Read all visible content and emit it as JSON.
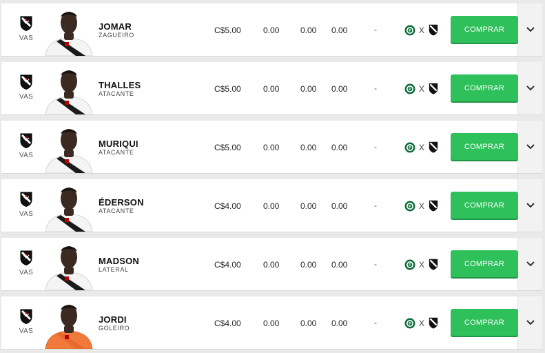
{
  "ui": {
    "buy_label": "COMPRAR",
    "match_separator": "X",
    "accent_color": "#2ec05b"
  },
  "players": [
    {
      "club": "VAS",
      "name": "JOMAR",
      "position": "ZAGUEIRO",
      "price": "C$5.00",
      "stat1": "0.00",
      "stat2": "0.00",
      "stat3": "0.00",
      "status": "-",
      "home_icon": "palmeiras-crest-icon",
      "away_icon": "vasco-crest-icon",
      "kit": "white"
    },
    {
      "club": "VAS",
      "name": "THALLES",
      "position": "ATACANTE",
      "price": "C$5.00",
      "stat1": "0.00",
      "stat2": "0.00",
      "stat3": "0.00",
      "status": "-",
      "home_icon": "palmeiras-crest-icon",
      "away_icon": "vasco-crest-icon",
      "kit": "white"
    },
    {
      "club": "VAS",
      "name": "MURIQUI",
      "position": "ATACANTE",
      "price": "C$5.00",
      "stat1": "0.00",
      "stat2": "0.00",
      "stat3": "0.00",
      "status": "-",
      "home_icon": "palmeiras-crest-icon",
      "away_icon": "vasco-crest-icon",
      "kit": "white"
    },
    {
      "club": "VAS",
      "name": "ÉDERSON",
      "position": "ATACANTE",
      "price": "C$4.00",
      "stat1": "0.00",
      "stat2": "0.00",
      "stat3": "0.00",
      "status": "-",
      "home_icon": "palmeiras-crest-icon",
      "away_icon": "vasco-crest-icon",
      "kit": "white"
    },
    {
      "club": "VAS",
      "name": "MADSON",
      "position": "LATERAL",
      "price": "C$4.00",
      "stat1": "0.00",
      "stat2": "0.00",
      "stat3": "0.00",
      "status": "-",
      "home_icon": "palmeiras-crest-icon",
      "away_icon": "vasco-crest-icon",
      "kit": "white"
    },
    {
      "club": "VAS",
      "name": "JORDI",
      "position": "GOLEIRO",
      "price": "C$4.00",
      "stat1": "0.00",
      "stat2": "0.00",
      "stat3": "0.00",
      "status": "-",
      "home_icon": "palmeiras-crest-icon",
      "away_icon": "vasco-crest-icon",
      "kit": "orange"
    }
  ]
}
